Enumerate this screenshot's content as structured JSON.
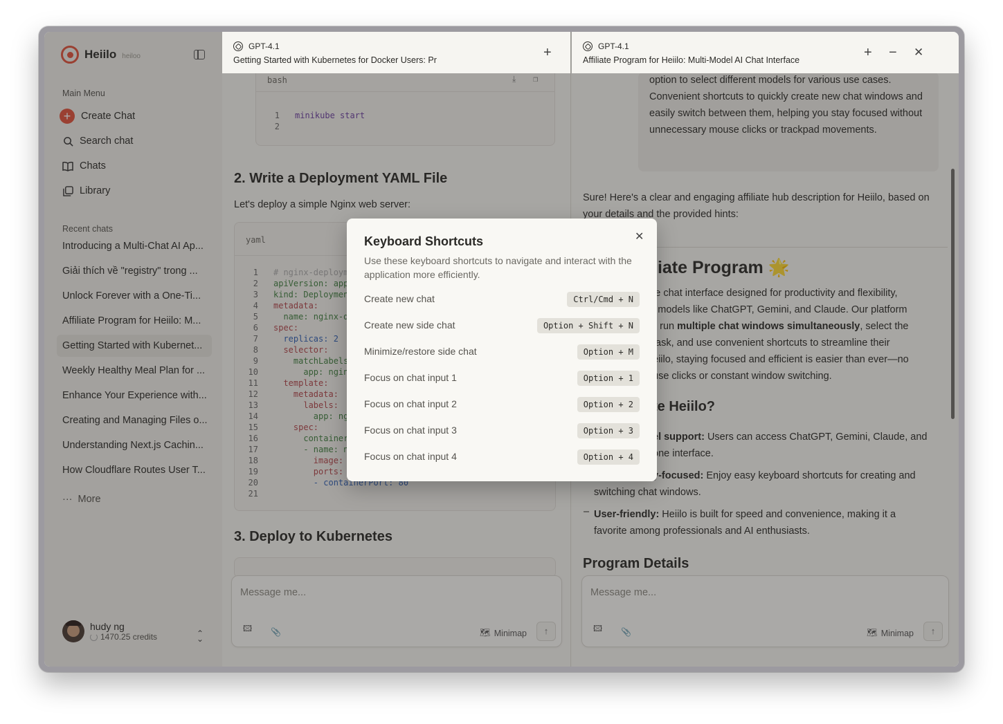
{
  "sidebar": {
    "brand_name": "Heiilo",
    "brand_domain": "heiloo",
    "main_menu_label": "Main Menu",
    "menu": [
      {
        "label": "Create Chat",
        "icon": "plus-icon"
      },
      {
        "label": "Search chat",
        "icon": "search-icon"
      },
      {
        "label": "Chats",
        "icon": "book-icon"
      },
      {
        "label": "Library",
        "icon": "library-icon"
      }
    ],
    "recent_label": "Recent chats",
    "recent": [
      "Introducing a Multi-Chat AI Ap...",
      "Giải thích về \"registry\" trong ...",
      "Unlock Forever with a One-Ti...",
      "Affiliate Program for Heiilo: M...",
      "Getting Started with Kubernet...",
      "Weekly Healthy Meal Plan for ...",
      "Enhance Your Experience with...",
      "Creating and Managing Files o...",
      "Understanding Next.js Cachin...",
      "How Cloudflare Routes User T..."
    ],
    "more_label": "More",
    "user_name": "hudy ng",
    "user_credits": "1470.25 credits"
  },
  "left_pane": {
    "model": "GPT-4.1",
    "title": "Getting Started with Kubernetes for Docker Users: Pr",
    "bash_lang": "bash",
    "bash_lines": [
      {
        "n": "1",
        "code": "minikube start"
      },
      {
        "n": "2",
        "code": ""
      }
    ],
    "heading_2": "2. Write a Deployment YAML File",
    "para_2": "Let's deploy a simple Nginx web server:",
    "yaml_lang": "yaml",
    "yaml_lines": [
      {
        "n": "1",
        "code": "# nginx-deploym"
      },
      {
        "n": "2",
        "code": "apiVersion: app"
      },
      {
        "n": "3",
        "code": "kind: Deploymen"
      },
      {
        "n": "4",
        "code": "metadata:"
      },
      {
        "n": "5",
        "code": "  name: nginx-d"
      },
      {
        "n": "6",
        "code": "spec:"
      },
      {
        "n": "7",
        "code": "  replicas: 2"
      },
      {
        "n": "8",
        "code": "  selector:"
      },
      {
        "n": "9",
        "code": "    matchLabels"
      },
      {
        "n": "10",
        "code": "      app: ngin"
      },
      {
        "n": "11",
        "code": "  template:"
      },
      {
        "n": "12",
        "code": "    metadata:"
      },
      {
        "n": "13",
        "code": "      labels:"
      },
      {
        "n": "14",
        "code": "        app: ng"
      },
      {
        "n": "15",
        "code": "    spec:"
      },
      {
        "n": "16",
        "code": "      container"
      },
      {
        "n": "17",
        "code": "      - name: n"
      },
      {
        "n": "18",
        "code": "        image:"
      },
      {
        "n": "19",
        "code": "        ports:"
      },
      {
        "n": "20",
        "code": "        - containerPort: 80"
      },
      {
        "n": "21",
        "code": ""
      }
    ],
    "heading_3": "3. Deploy to Kubernetes",
    "input_placeholder": "Message me...",
    "minimap_label": "Minimap"
  },
  "right_pane": {
    "model": "GPT-4.1",
    "title": "Affiliate Program for Heiilo: Multi-Model AI Chat Interface",
    "bubble_lines": [
      "option to select different models for various use cases.",
      "Convenient shortcuts to quickly create new chat windows and",
      "easily switch between them, helping you stay focused without",
      "unnecessary mouse clicks or trackpad movements."
    ],
    "intro_1": "Sure! Here's a clear and engaging affiliate hub description for Heiilo, based on",
    "intro_2": "your details and the provided hints:",
    "h1": "liate Program 🌟",
    "p_lines": [
      "le chat interface designed for productivity and flexibility,",
      "l models like ChatGPT, Gemini, and Claude. Our platform",
      "to run ",
      "task, and use convenient shortcuts to streamline their",
      "eiilo, staying focused and efficient is easier than ever—no",
      "use clicks or constant window switching."
    ],
    "p_bold": "multiple chat windows simultaneously",
    "p_after_bold": ", select the",
    "h2": "te Heiilo?",
    "list": [
      {
        "bold": "el support:",
        "text": " Users can access ChatGPT, Gemini, Claude, and",
        "cont": "one interface."
      },
      {
        "bold": "y-focused:",
        "text": " Enjoy easy keyboard shortcuts for creating and",
        "cont": "switching chat windows."
      },
      {
        "bold": "User-friendly:",
        "text": " Heiilo is built for speed and convenience, making it a",
        "cont": "favorite among professionals and AI enthusiasts."
      }
    ],
    "h3": "Program Details",
    "input_placeholder": "Message me...",
    "minimap_label": "Minimap"
  },
  "modal": {
    "title": "Keyboard Shortcuts",
    "description": "Use these keyboard shortcuts to navigate and interact with the application more efficiently.",
    "shortcuts": [
      {
        "label": "Create new chat",
        "keys": "Ctrl/Cmd + N"
      },
      {
        "label": "Create new side chat",
        "keys": "Option + Shift + N"
      },
      {
        "label": "Minimize/restore side chat",
        "keys": "Option + M"
      },
      {
        "label": "Focus on chat input 1",
        "keys": "Option + 1"
      },
      {
        "label": "Focus on chat input 2",
        "keys": "Option + 2"
      },
      {
        "label": "Focus on chat input 3",
        "keys": "Option + 3"
      },
      {
        "label": "Focus on chat input 4",
        "keys": "Option + 4"
      }
    ]
  },
  "colors": {
    "accent": "#e0523a",
    "overlay": "rgba(40,38,36,0.38)"
  }
}
